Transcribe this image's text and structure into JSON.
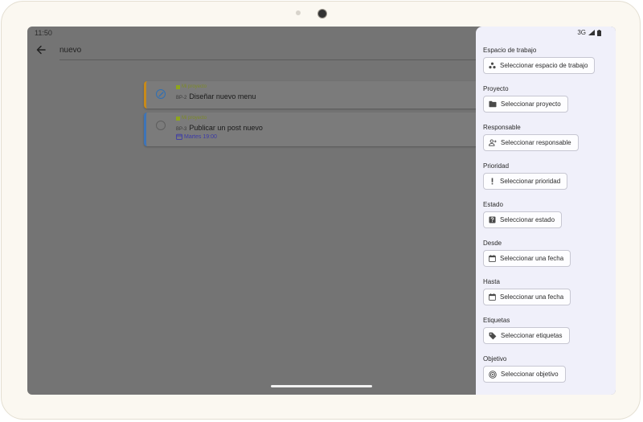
{
  "status_bar": {
    "time": "11:50",
    "network": "3G"
  },
  "search": {
    "query": "nuevo"
  },
  "tasks": [
    {
      "project": "Mi proyecto",
      "code": "BP-2",
      "title": "Diseñar nuevo menu",
      "completed": true,
      "accent_color": "#c88a1a"
    },
    {
      "project": "Mi proyecto",
      "code": "BP-3",
      "title": "Publicar un post nuevo",
      "completed": false,
      "due": "Martes 19:00",
      "accent_color": "#3d74b8"
    }
  ],
  "filters": [
    {
      "label": "Espacio de trabajo",
      "button": "Seleccionar espacio de trabajo",
      "icon": "workspace-icon"
    },
    {
      "label": "Proyecto",
      "button": "Seleccionar proyecto",
      "icon": "folder-icon"
    },
    {
      "label": "Responsable",
      "button": "Seleccionar responsable",
      "icon": "person-add-icon"
    },
    {
      "label": "Prioridad",
      "button": "Seleccionar prioridad",
      "icon": "priority-icon"
    },
    {
      "label": "Estado",
      "button": "Seleccionar estado",
      "icon": "status-icon"
    },
    {
      "label": "Desde",
      "button": "Seleccionar una fecha",
      "icon": "calendar-icon"
    },
    {
      "label": "Hasta",
      "button": "Seleccionar una fecha",
      "icon": "calendar-icon"
    },
    {
      "label": "Etiquetas",
      "button": "Seleccionar etiquetas",
      "icon": "tag-icon"
    },
    {
      "label": "Objetivo",
      "button": "Seleccionar objetivo",
      "icon": "target-icon"
    }
  ],
  "colors": {
    "scrim": "#747474",
    "panel": "#f0f0fa",
    "due_date": "#3c3aa8",
    "project_tag": "#8ea51c"
  }
}
